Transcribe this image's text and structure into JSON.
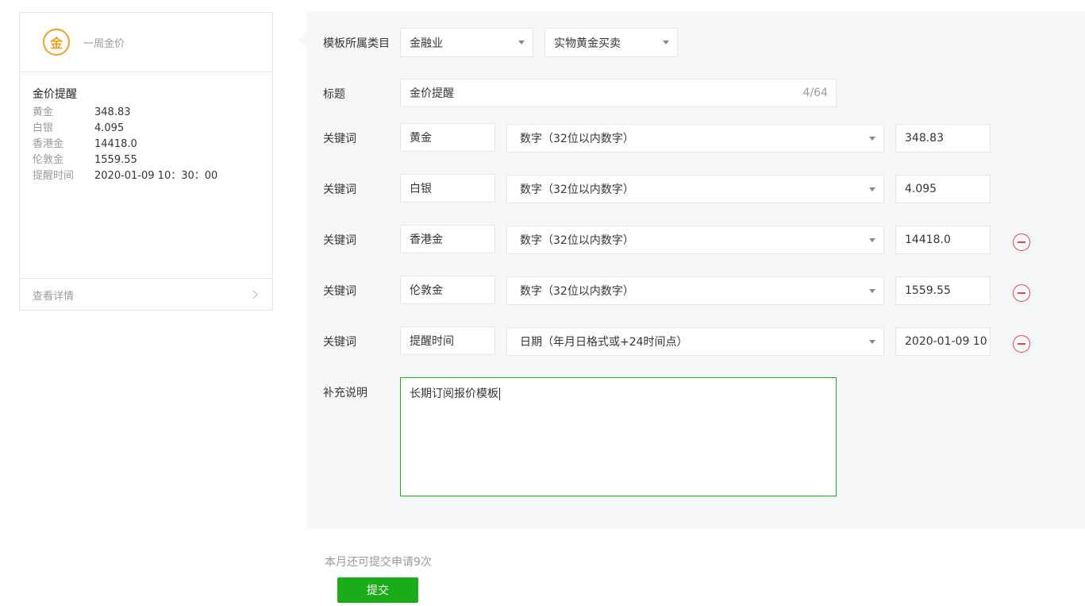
{
  "card": {
    "logo_char": "金",
    "app_name": "一周金价",
    "title": "金价提醒",
    "rows": [
      {
        "key": "黄金",
        "value": "348.83"
      },
      {
        "key": "白银",
        "value": "4.095"
      },
      {
        "key": "香港金",
        "value": "14418.0"
      },
      {
        "key": "伦敦金",
        "value": "1559.55"
      },
      {
        "key": "提醒时间",
        "value": "2020-01-09 10：30：00"
      }
    ],
    "footer_link": "查看详情"
  },
  "form": {
    "category_label": "模板所属类目",
    "category_primary": "金融业",
    "category_secondary": "实物黄金买卖",
    "title_label": "标题",
    "title_value": "金价提醒",
    "title_counter": "4/64",
    "keyword_label": "关键词",
    "keywords": [
      {
        "name": "黄金",
        "type": "数字（32位以内数字）",
        "example": "348.83",
        "removable": false
      },
      {
        "name": "白银",
        "type": "数字（32位以内数字）",
        "example": "4.095",
        "removable": false
      },
      {
        "name": "香港金",
        "type": "数字（32位以内数字）",
        "example": "14418.0",
        "removable": true
      },
      {
        "name": "伦敦金",
        "type": "数字（32位以内数字）",
        "example": "1559.55",
        "removable": true
      },
      {
        "name": "提醒时间",
        "type": "日期（年月日格式或+24时间点）",
        "example": "2020-01-09 10",
        "removable": true
      }
    ],
    "notes_label": "补充说明",
    "notes_value": "长期订阅报价模板"
  },
  "footer": {
    "quota_text": "本月还可提交申请9次",
    "submit_label": "提交"
  },
  "colors": {
    "accent": "#1aad19",
    "danger": "#e64340",
    "logo": "#f0a020",
    "panel_bg": "#f6f7f9"
  }
}
